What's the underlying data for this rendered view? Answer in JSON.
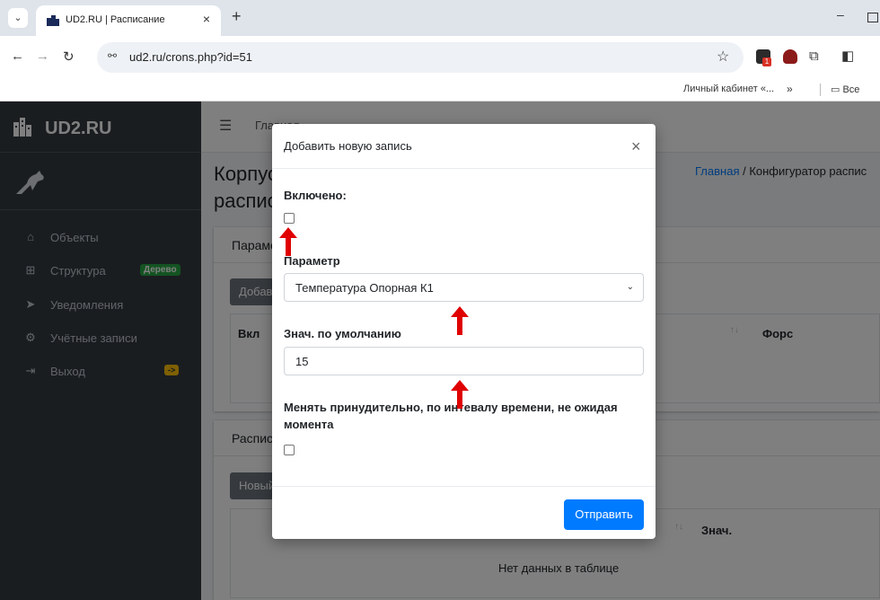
{
  "browser": {
    "tab_title": "UD2.RU | Расписание",
    "tab_close": "×",
    "new_tab": "+",
    "minimize": "–",
    "url": "ud2.ru/crons.php?id=51",
    "bookmark_lk": "Личный кабинет «...",
    "bookmark_more": "»",
    "bookmark_all": "Все"
  },
  "sidebar": {
    "brand": "UD2.RU",
    "items": [
      {
        "label": "Объекты",
        "icon": "home-icon",
        "glyph": "⌂"
      },
      {
        "label": "Структура",
        "icon": "sitemap-icon",
        "glyph": "⊞",
        "badge": "Дерево"
      },
      {
        "label": "Уведомления",
        "icon": "paper-plane-icon",
        "glyph": "➤"
      },
      {
        "label": "Учётные записи",
        "icon": "users-cog-icon",
        "glyph": "⚙"
      },
      {
        "label": "Выход",
        "icon": "sign-out-icon",
        "glyph": "⇥",
        "badge": "->"
      }
    ]
  },
  "topnav": {
    "home_link": "Главная"
  },
  "content": {
    "title_line1": "Корпус",
    "title_line2": "распис",
    "breadcrumb_home": "Главная",
    "breadcrumb_sep": " / ",
    "breadcrumb_current": "Конфигуратор распис",
    "card1": {
      "header": "Параметры",
      "add_button": "Добавить",
      "col_vkl": "Вкл",
      "col_sort": "↑↓",
      "col_fors": "Форс"
    },
    "card2": {
      "header": "Расписание",
      "new_button": "Новый",
      "col_sort": "↑↓",
      "col_znach": "Знач.",
      "empty": "Нет данных в таблице"
    }
  },
  "modal": {
    "title": "Добавить новую запись",
    "close": "×",
    "enabled_label": "Включено:",
    "param_label": "Параметр",
    "param_value": "Температура Опорная К1",
    "default_label": "Знач. по умолчанию",
    "default_value": "15",
    "force_label_line1": "Менять принудительно, по интевалу времени, не ожидая",
    "force_label_line2": "момента",
    "submit": "Отправить"
  },
  "colors": {
    "sidebar_bg": "#343a40",
    "primary": "#007bff",
    "annotation_arrow": "#e00000"
  }
}
